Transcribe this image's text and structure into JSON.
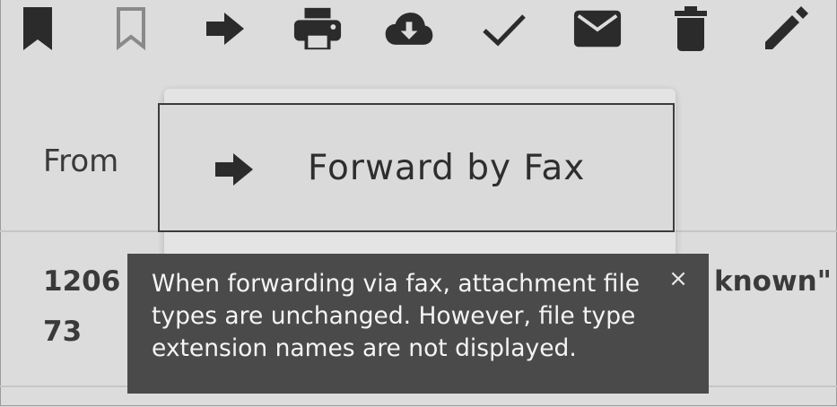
{
  "toolbar": {
    "buttons": [
      {
        "name": "bookmark-filled-icon"
      },
      {
        "name": "bookmark-outline-icon"
      },
      {
        "name": "forward-arrow-icon"
      },
      {
        "name": "print-icon"
      },
      {
        "name": "cloud-download-icon"
      },
      {
        "name": "checkmark-icon"
      },
      {
        "name": "envelope-icon"
      },
      {
        "name": "trash-icon"
      },
      {
        "name": "pencil-icon"
      }
    ]
  },
  "header": {
    "from_label": "From"
  },
  "row": {
    "line1_left": "1206",
    "line1_right": "known\" -",
    "line2_left": "73"
  },
  "menu": {
    "items": [
      {
        "label": "Forward by Fax",
        "icon": "forward-arrow-icon"
      }
    ]
  },
  "tooltip": {
    "text": "When forwarding via fax, attachment file types are unchanged. However, file type extension names are not displayed.",
    "close_glyph": "×"
  },
  "colors": {
    "background": "#dcdcdc",
    "icon": "#2b2b2b",
    "icon_muted": "#8a8a8a",
    "tooltip_bg": "#4a4a4a",
    "tooltip_text": "#f4f4f4"
  }
}
